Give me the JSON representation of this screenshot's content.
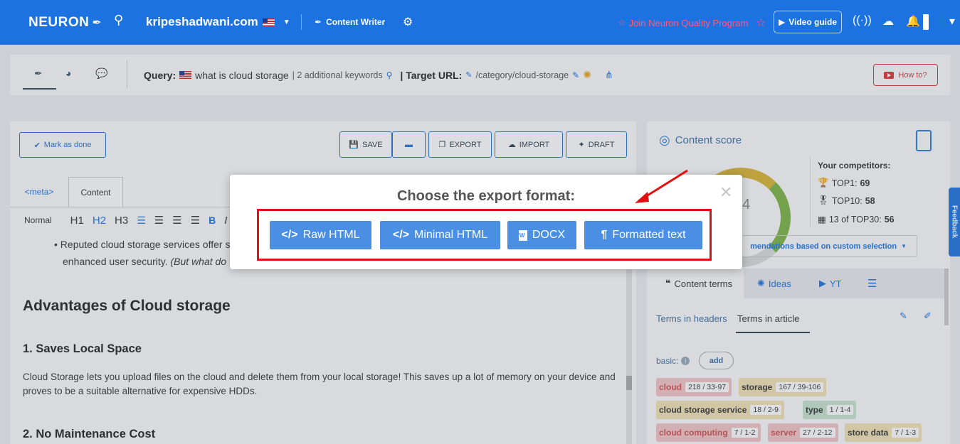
{
  "nav": {
    "logo": "NEURON",
    "domain": "kripeshadwani.com",
    "content_writer": "Content Writer",
    "join_program": "Join Neuron Quality Program",
    "video_guide": "Video guide"
  },
  "subheader": {
    "query_label": "Query:",
    "query": "what is cloud storage",
    "keywords": "| 2 additional keywords",
    "target_label": "| Target URL:",
    "target_url": "/category/cloud-storage",
    "how_to": "How to?"
  },
  "editor": {
    "mark_done": "Mark as done",
    "save": "SAVE",
    "export": "EXPORT",
    "import": "IMPORT",
    "draft": "DRAFT",
    "tab_meta": "<meta>",
    "tab_content": "Content",
    "format_normal": "Normal",
    "bullet_text": "Reputed cloud storage services offer s",
    "bullet_text2": "enhanced user security.",
    "bullet_italic": "(But what do",
    "heading_advantages": "Advantages of Cloud storage",
    "heading_1": "1. Saves Local Space",
    "para_1": "Cloud Storage lets you upload files on the cloud and delete them from your local storage! This saves up a lot of memory on your device and proves to be a suitable alternative for expensive HDDs.",
    "heading_2": "2. No Maintenance Cost"
  },
  "right": {
    "content_score": "Content score",
    "score_partial": "4",
    "competitors_title": "Your competitors:",
    "top1": "TOP1:",
    "top1_val": "69",
    "top10": "TOP10:",
    "top10_val": "58",
    "top30": "13 of TOP30:",
    "top30_val": "56",
    "recommendations": "mendations based on custom selection",
    "tab_terms": "Content terms",
    "tab_ideas": "Ideas",
    "tab_yt": "YT",
    "terms_headers": "Terms in headers",
    "terms_article": "Terms in article",
    "basic": "basic:",
    "add": "add",
    "chips": [
      {
        "term": "cloud",
        "count": "218 / 33-97",
        "color": "red"
      },
      {
        "term": "storage",
        "count": "167 / 39-106",
        "color": "yellow"
      },
      {
        "term": "cloud storage service",
        "count": "18 / 2-9",
        "color": "yellow"
      },
      {
        "term": "type",
        "count": "1 / 1-4",
        "color": "green"
      },
      {
        "term": "cloud computing",
        "count": "7 / 1-2",
        "color": "red"
      },
      {
        "term": "server",
        "count": "27 / 2-12",
        "color": "red"
      },
      {
        "term": "store data",
        "count": "7 / 1-3",
        "color": "yellow"
      }
    ],
    "feedback": "Feedback"
  },
  "modal": {
    "title": "Choose the export format:",
    "buttons": {
      "raw_html": "Raw HTML",
      "minimal_html": "Minimal HTML",
      "docx": "DOCX",
      "formatted_text": "Formatted text"
    }
  },
  "colors": {
    "primary": "#1b72e0",
    "modal_button": "#4a8fe4",
    "highlight": "#e01010"
  }
}
